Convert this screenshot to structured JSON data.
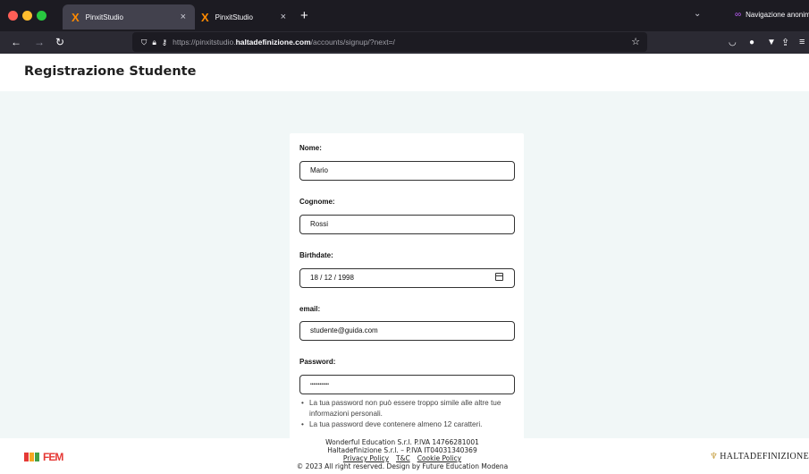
{
  "browser": {
    "tabs": [
      {
        "title": "PinxitStudio",
        "icon": "pinxit-x-icon",
        "close": "×"
      },
      {
        "title": "PinxitStudio",
        "icon": "pinxit-x-icon",
        "close": "×"
      }
    ],
    "new_tab": "+",
    "private_label": "Navigazione anonima",
    "url_prefix": "https://pinxitstudio.",
    "url_host": "haltadefinizione.com",
    "url_path": "/accounts/signup/?next=/"
  },
  "page": {
    "title": "Registrazione Studente"
  },
  "form": {
    "nome_label": "Nome:",
    "nome_value": "Mario",
    "cognome_label": "Cognome:",
    "cognome_value": "Rossi",
    "birthdate_label": "Birthdate:",
    "birthdate_value": "18 / 12 / 1998",
    "email_label": "email:",
    "email_value": "studente@guida.com",
    "password_label": "Password:",
    "password_value": "••••••••••••",
    "help": [
      "La tua password non può essere troppo simile alle altre tue informazioni personali.",
      "La tua password deve contenere almeno 12 caratteri."
    ]
  },
  "footer": {
    "line1": "Wonderful Education S.r.l. P.IVA 14766281001",
    "line2": "Haltadefinizione S.r.l. – P.IVA IT04031340369",
    "privacy": "Privacy Policy",
    "tc": "T&C",
    "cookie": "Cookie Policy",
    "copyright": "© 2023 All right reserved. Design by Future Education Modena",
    "left_logo": "FEM",
    "right_logo": "HALTADEFINIZIONE"
  },
  "colors": {
    "accent": "#ff8a00",
    "private": "#c060ff",
    "background": "#f1f7f7"
  }
}
